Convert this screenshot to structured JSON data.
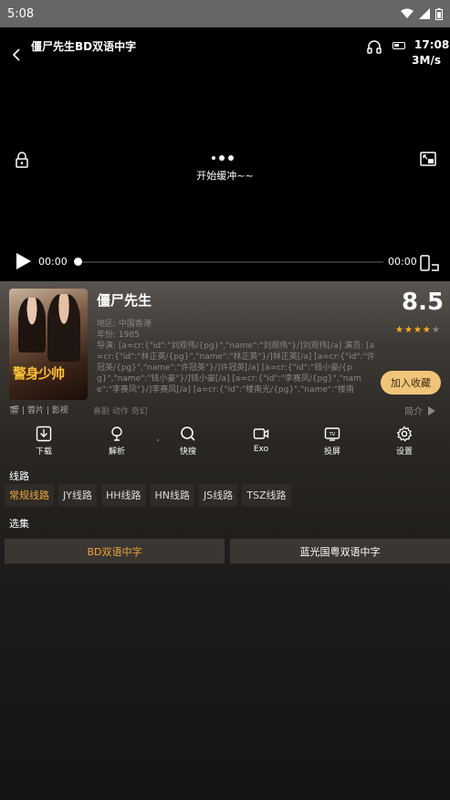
{
  "status_bar": {
    "time": "5:08"
  },
  "player": {
    "title": "僵尸先生BD双语中字",
    "clock": "17:08",
    "speed": "3M/s",
    "buffer_text": "开始缓冲~~",
    "current_time": "00:00",
    "total_time": "00:00",
    "progress_percent": 0
  },
  "movie": {
    "poster_text": "警身少帅",
    "title": "僵尸先生",
    "region": "地区: 中国香港",
    "year": "年份: 1985",
    "cast": "导演: [a=cr:{\"id\":\"刘观伟/{pg}\",\"name\":\"刘观伟\"}/]刘观伟[/a] 演员: [a=cr:{\"id\":\"林正英/{pg}\",\"name\":\"林正英\"}/]林正英[/a] [a=cr:{\"id\":\"许冠英/{pg}\",\"name\":\"许冠英\"}/]许冠英[/a] [a=cr:{\"id\":\"钱小豪/{pg}\",\"name\":\"钱小豪\"}/]钱小豪[/a] [a=cr:{\"id\":\"李赛凤/{pg}\",\"name\":\"李赛凤\"}/]李赛凤[/a] [a=cr:{\"id\":\"楼南光/{pg}\",\"name\":\"楼南光\"}/]楼南光[...",
    "score": "8.5",
    "rating_stars": 4.5,
    "fav_label": "加入收藏",
    "source": "🎬 | 蓉片 | 影视",
    "genres": "喜剧 动作 奇幻",
    "intro_label": "简介"
  },
  "tools": [
    {
      "label": "下载",
      "icon": "download-icon"
    },
    {
      "label": "解析",
      "icon": "parse-icon"
    },
    {
      "label": "快搜",
      "icon": "search-icon"
    },
    {
      "label": "Exo",
      "icon": "video-icon"
    },
    {
      "label": "投屏",
      "icon": "tv-icon"
    },
    {
      "label": "设置",
      "icon": "gear-icon"
    }
  ],
  "lines_label": "线路",
  "lines": [
    "常规线路",
    "JY线路",
    "HH线路",
    "HN线路",
    "JS线路",
    "TSZ线路"
  ],
  "episodes_label": "选集",
  "episodes": [
    "BD双语中字",
    "蓝光国粤双语中字"
  ],
  "colors": {
    "accent": "#f0a43a",
    "fav_bg": "#f0c57a",
    "star": "#f5b026"
  }
}
